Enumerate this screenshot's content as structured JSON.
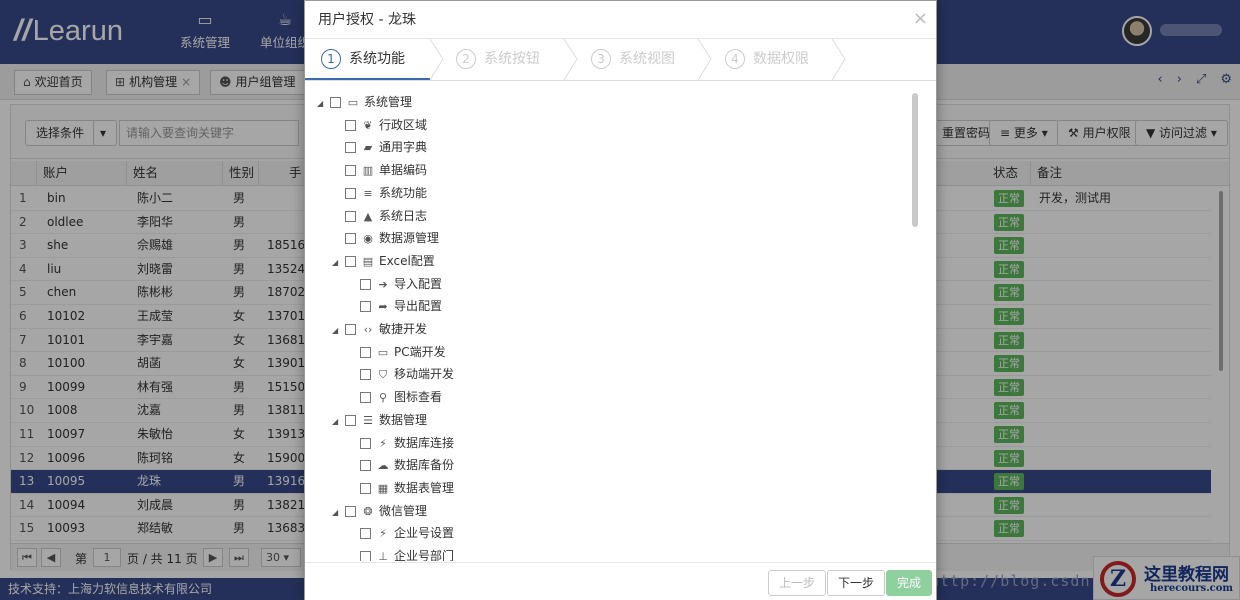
{
  "header": {
    "logo_text": "Learun",
    "nav": [
      {
        "label": "系统管理",
        "icon": "monitor-icon"
      },
      {
        "label": "单位组织",
        "icon": "coffee-icon"
      }
    ]
  },
  "tabs": [
    {
      "label": "欢迎首页",
      "icon": "home-icon"
    },
    {
      "label": "机构管理",
      "icon": "sitemap-icon"
    },
    {
      "label": "用户组管理",
      "icon": "users-icon"
    }
  ],
  "toolbar": {
    "select_label": "选择条件",
    "search_placeholder": "请输入要查询关键字",
    "reset_password": "重置密码",
    "more": "更多",
    "user_permission": "用户权限",
    "access_filter": "访问过滤"
  },
  "grid": {
    "columns": [
      "账户",
      "姓名",
      "性别",
      "手",
      "状态",
      "备注"
    ],
    "rows": [
      {
        "no": "1",
        "account": "bin",
        "name": "陈小二",
        "gender": "男",
        "phone": "",
        "status": "正常",
        "note": "开发，测试用"
      },
      {
        "no": "2",
        "account": "oldlee",
        "name": "李阳华",
        "gender": "男",
        "phone": "",
        "status": "正常",
        "note": ""
      },
      {
        "no": "3",
        "account": "she",
        "name": "佘赐雄",
        "gender": "男",
        "phone": "18516",
        "status": "正常",
        "note": ""
      },
      {
        "no": "4",
        "account": "liu",
        "name": "刘晓雷",
        "gender": "男",
        "phone": "13524",
        "status": "正常",
        "note": ""
      },
      {
        "no": "5",
        "account": "chen",
        "name": "陈彬彬",
        "gender": "男",
        "phone": "18702",
        "status": "正常",
        "note": ""
      },
      {
        "no": "6",
        "account": "10102",
        "name": "王成莹",
        "gender": "女",
        "phone": "13701",
        "status": "正常",
        "note": ""
      },
      {
        "no": "7",
        "account": "10101",
        "name": "李宇嘉",
        "gender": "女",
        "phone": "13681",
        "status": "正常",
        "note": ""
      },
      {
        "no": "8",
        "account": "10100",
        "name": "胡菡",
        "gender": "女",
        "phone": "13901",
        "status": "正常",
        "note": ""
      },
      {
        "no": "9",
        "account": "10099",
        "name": "林有强",
        "gender": "男",
        "phone": "15150",
        "status": "正常",
        "note": ""
      },
      {
        "no": "10",
        "account": "1008",
        "name": "沈嘉",
        "gender": "男",
        "phone": "13811",
        "status": "正常",
        "note": ""
      },
      {
        "no": "11",
        "account": "10097",
        "name": "朱敏怡",
        "gender": "女",
        "phone": "13913",
        "status": "正常",
        "note": ""
      },
      {
        "no": "12",
        "account": "10096",
        "name": "陈珂铭",
        "gender": "女",
        "phone": "15900",
        "status": "正常",
        "note": ""
      },
      {
        "no": "13",
        "account": "10095",
        "name": "龙珠",
        "gender": "男",
        "phone": "13916",
        "status": "正常",
        "note": ""
      },
      {
        "no": "14",
        "account": "10094",
        "name": "刘成晨",
        "gender": "男",
        "phone": "13821",
        "status": "正常",
        "note": ""
      },
      {
        "no": "15",
        "account": "10093",
        "name": "郑结敏",
        "gender": "男",
        "phone": "13683",
        "status": "正常",
        "note": ""
      }
    ],
    "selected_row": 13
  },
  "pager": {
    "page_prefix": "第",
    "page": "1",
    "page_suffix": "页 / 共 11 页",
    "page_size": "30"
  },
  "footer": {
    "text": "技术支持：上海力软信息技术有限公司"
  },
  "watermark": "http://blog.csdn.",
  "site_logo": {
    "title": "这里教程网",
    "url": "herecours.com"
  },
  "modal": {
    "title": "用户授权 - 龙珠",
    "steps": [
      {
        "n": "1",
        "label": "系统功能"
      },
      {
        "n": "2",
        "label": "系统按钮"
      },
      {
        "n": "3",
        "label": "系统视图"
      },
      {
        "n": "4",
        "label": "数据权限"
      }
    ],
    "tree": [
      {
        "label": "系统管理",
        "level": 0,
        "toggle": true,
        "icon": "desktop-icon",
        "glyph": "▭"
      },
      {
        "label": "行政区域",
        "level": 1,
        "toggle": false,
        "icon": "leaf-icon",
        "glyph": "❦"
      },
      {
        "label": "通用字典",
        "level": 1,
        "toggle": false,
        "icon": "book-icon",
        "glyph": "▰"
      },
      {
        "label": "单据编码",
        "level": 1,
        "toggle": false,
        "icon": "barcode-icon",
        "glyph": "▥"
      },
      {
        "label": "系统功能",
        "level": 1,
        "toggle": false,
        "icon": "list-icon",
        "glyph": "≡"
      },
      {
        "label": "系统日志",
        "level": 1,
        "toggle": false,
        "icon": "warning-icon",
        "glyph": "▲"
      },
      {
        "label": "数据源管理",
        "level": 1,
        "toggle": false,
        "icon": "dot-circle-icon",
        "glyph": "◉"
      },
      {
        "label": "Excel配置",
        "level": 1,
        "toggle": true,
        "icon": "excel-file-icon",
        "glyph": "▤"
      },
      {
        "label": "导入配置",
        "level": 2,
        "toggle": false,
        "icon": "sign-in-icon",
        "glyph": "➔"
      },
      {
        "label": "导出配置",
        "level": 2,
        "toggle": false,
        "icon": "share-icon",
        "glyph": "➦"
      },
      {
        "label": "敏捷开发",
        "level": 1,
        "toggle": true,
        "icon": "code-icon",
        "glyph": "‹›"
      },
      {
        "label": "PC端开发",
        "level": 2,
        "toggle": false,
        "icon": "desktop-icon",
        "glyph": "▭"
      },
      {
        "label": "移动端开发",
        "level": 2,
        "toggle": false,
        "icon": "html5-icon",
        "glyph": "⛉"
      },
      {
        "label": "图标查看",
        "level": 2,
        "toggle": false,
        "icon": "search-icon",
        "glyph": "⚲"
      },
      {
        "label": "数据管理",
        "level": 1,
        "toggle": true,
        "icon": "database-icon",
        "glyph": "☰"
      },
      {
        "label": "数据库连接",
        "level": 2,
        "toggle": false,
        "icon": "plug-icon",
        "glyph": "⚡"
      },
      {
        "label": "数据库备份",
        "level": 2,
        "toggle": false,
        "icon": "cloud-icon",
        "glyph": "☁"
      },
      {
        "label": "数据表管理",
        "level": 2,
        "toggle": false,
        "icon": "table-icon",
        "glyph": "▦"
      },
      {
        "label": "微信管理",
        "level": 1,
        "toggle": true,
        "icon": "wechat-icon",
        "glyph": "❂"
      },
      {
        "label": "企业号设置",
        "level": 2,
        "toggle": false,
        "icon": "plug-icon",
        "glyph": "⚡"
      },
      {
        "label": "企业号部门",
        "level": 2,
        "toggle": false,
        "icon": "sitemap-icon",
        "glyph": "⊥"
      }
    ],
    "buttons": {
      "prev": "上一步",
      "next": "下一步",
      "finish": "完成"
    }
  }
}
